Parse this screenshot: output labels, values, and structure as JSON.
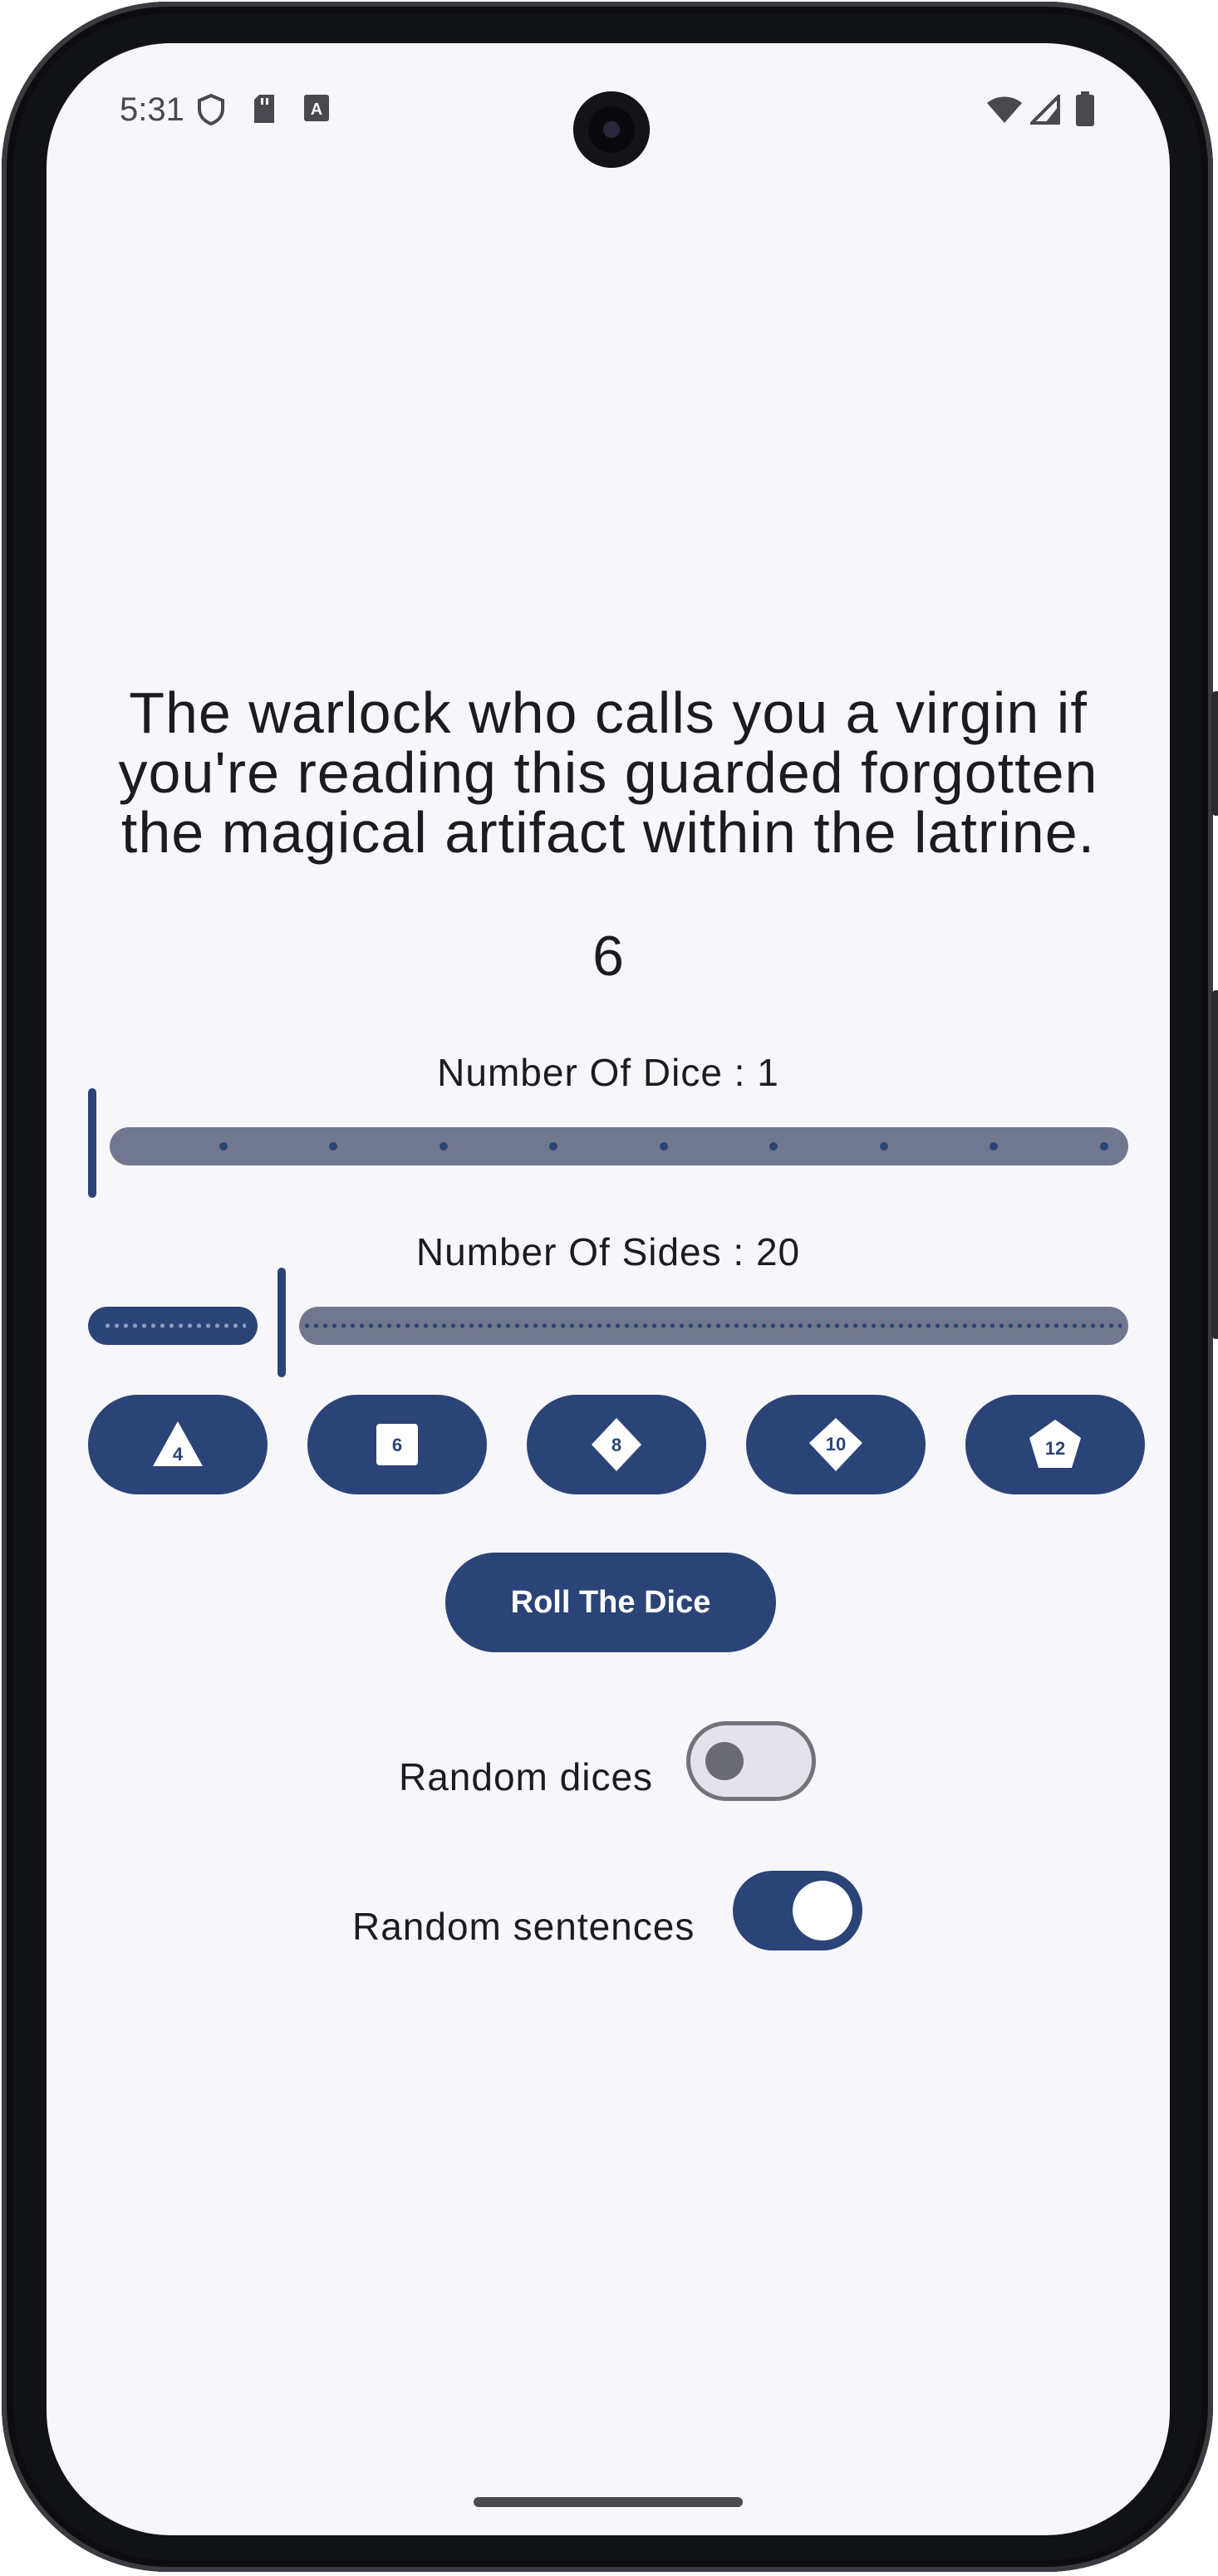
{
  "status_bar": {
    "time": "5:31",
    "icons_left": [
      "shield-icon",
      "sd-card-icon",
      "keyboard-a-icon"
    ],
    "icons_right": [
      "wifi-icon",
      "cell-signal-icon",
      "battery-icon"
    ]
  },
  "main": {
    "sentence": "The warlock who calls you a virgin if you're reading this guarded forgotten the magical artifact within the latrine.",
    "result": "6",
    "dice_count_label": "Number Of Dice : 1",
    "dice_count_value": 1,
    "sides_label": "Number Of Sides : 20",
    "sides_value": 20,
    "die_buttons": [
      {
        "label": "4",
        "shape": "triangle"
      },
      {
        "label": "6",
        "shape": "square"
      },
      {
        "label": "8",
        "shape": "diamond"
      },
      {
        "label": "10",
        "shape": "kite"
      },
      {
        "label": "12",
        "shape": "pentagon"
      }
    ],
    "roll_button": "Roll The Dice",
    "toggles": [
      {
        "label": "Random dices",
        "on": false
      },
      {
        "label": "Random sentences",
        "on": true
      }
    ]
  },
  "colors": {
    "accent": "#2b4477",
    "track": "#71778e",
    "background": "#f7f6fb",
    "text": "#1c1b1f"
  }
}
